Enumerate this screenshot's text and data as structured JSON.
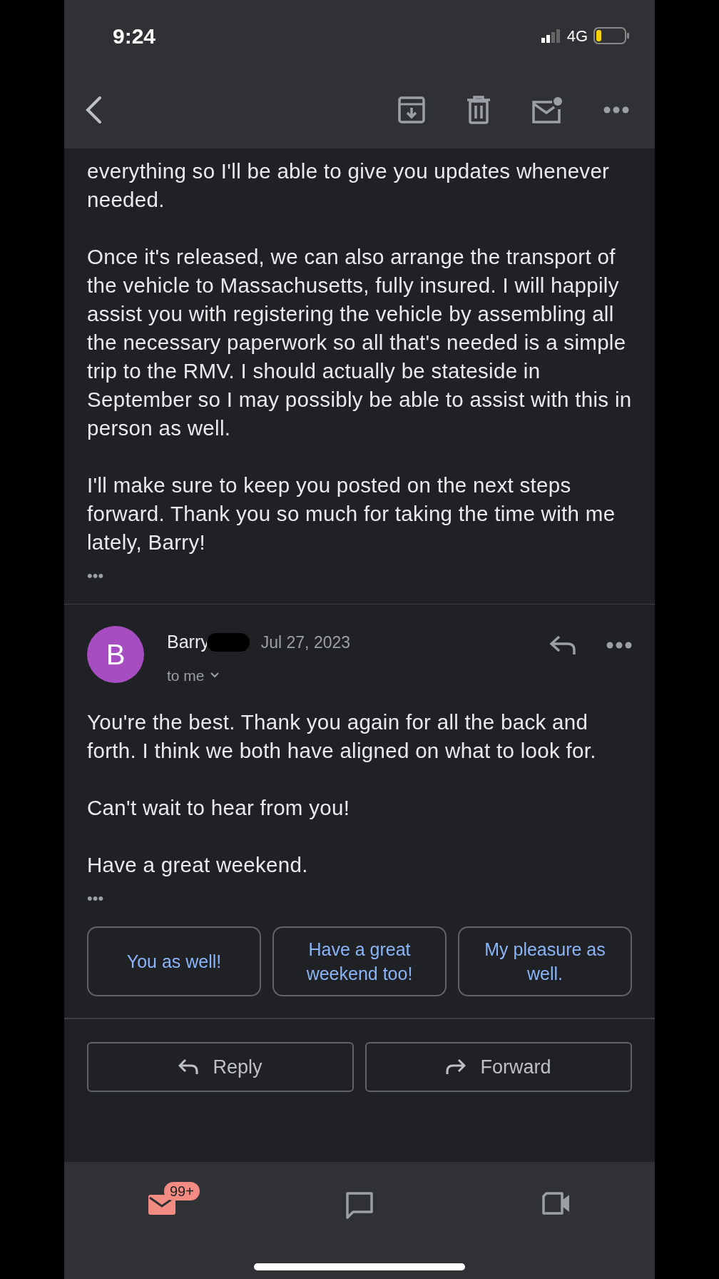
{
  "status_bar": {
    "time": "9:24",
    "network": "4G"
  },
  "messages": [
    {
      "paragraphs": [
        "everything so I'll be able to give you updates whenever needed.",
        "Once it's released, we can also arrange the transport of the vehicle to Massachusetts, fully insured. I will happily assist you with registering the vehicle by assembling all the necessary paperwork so all that's needed is a simple trip to the RMV. I should actually be stateside in September so I may possibly be able to assist with this in person as well.",
        "I'll make sure to keep you posted on the next steps forward. Thank you so much for taking the time with me lately, Barry!"
      ],
      "more": "•••"
    },
    {
      "avatar": "B",
      "color": "#a64dc2",
      "sender": "Barry",
      "redacted": true,
      "date": "Jul 27, 2023",
      "recipient": "to me",
      "paragraphs": [
        "You're the best. Thank you again for all the back and forth. I think we both have aligned on what to look for.",
        "Can't wait to hear from you!",
        "Have a great weekend."
      ],
      "more": "•••"
    }
  ],
  "smart_replies": [
    "You as well!",
    "Have a great weekend too!",
    "My pleasure as well."
  ],
  "actions": [
    {
      "kind": "reply",
      "label": "Reply"
    },
    {
      "kind": "forward",
      "label": "Forward"
    }
  ],
  "bottom_nav": [
    {
      "kind": "mail",
      "selected": true,
      "badge": "99+"
    },
    {
      "kind": "chat",
      "selected": false
    },
    {
      "kind": "meet",
      "selected": false
    }
  ]
}
